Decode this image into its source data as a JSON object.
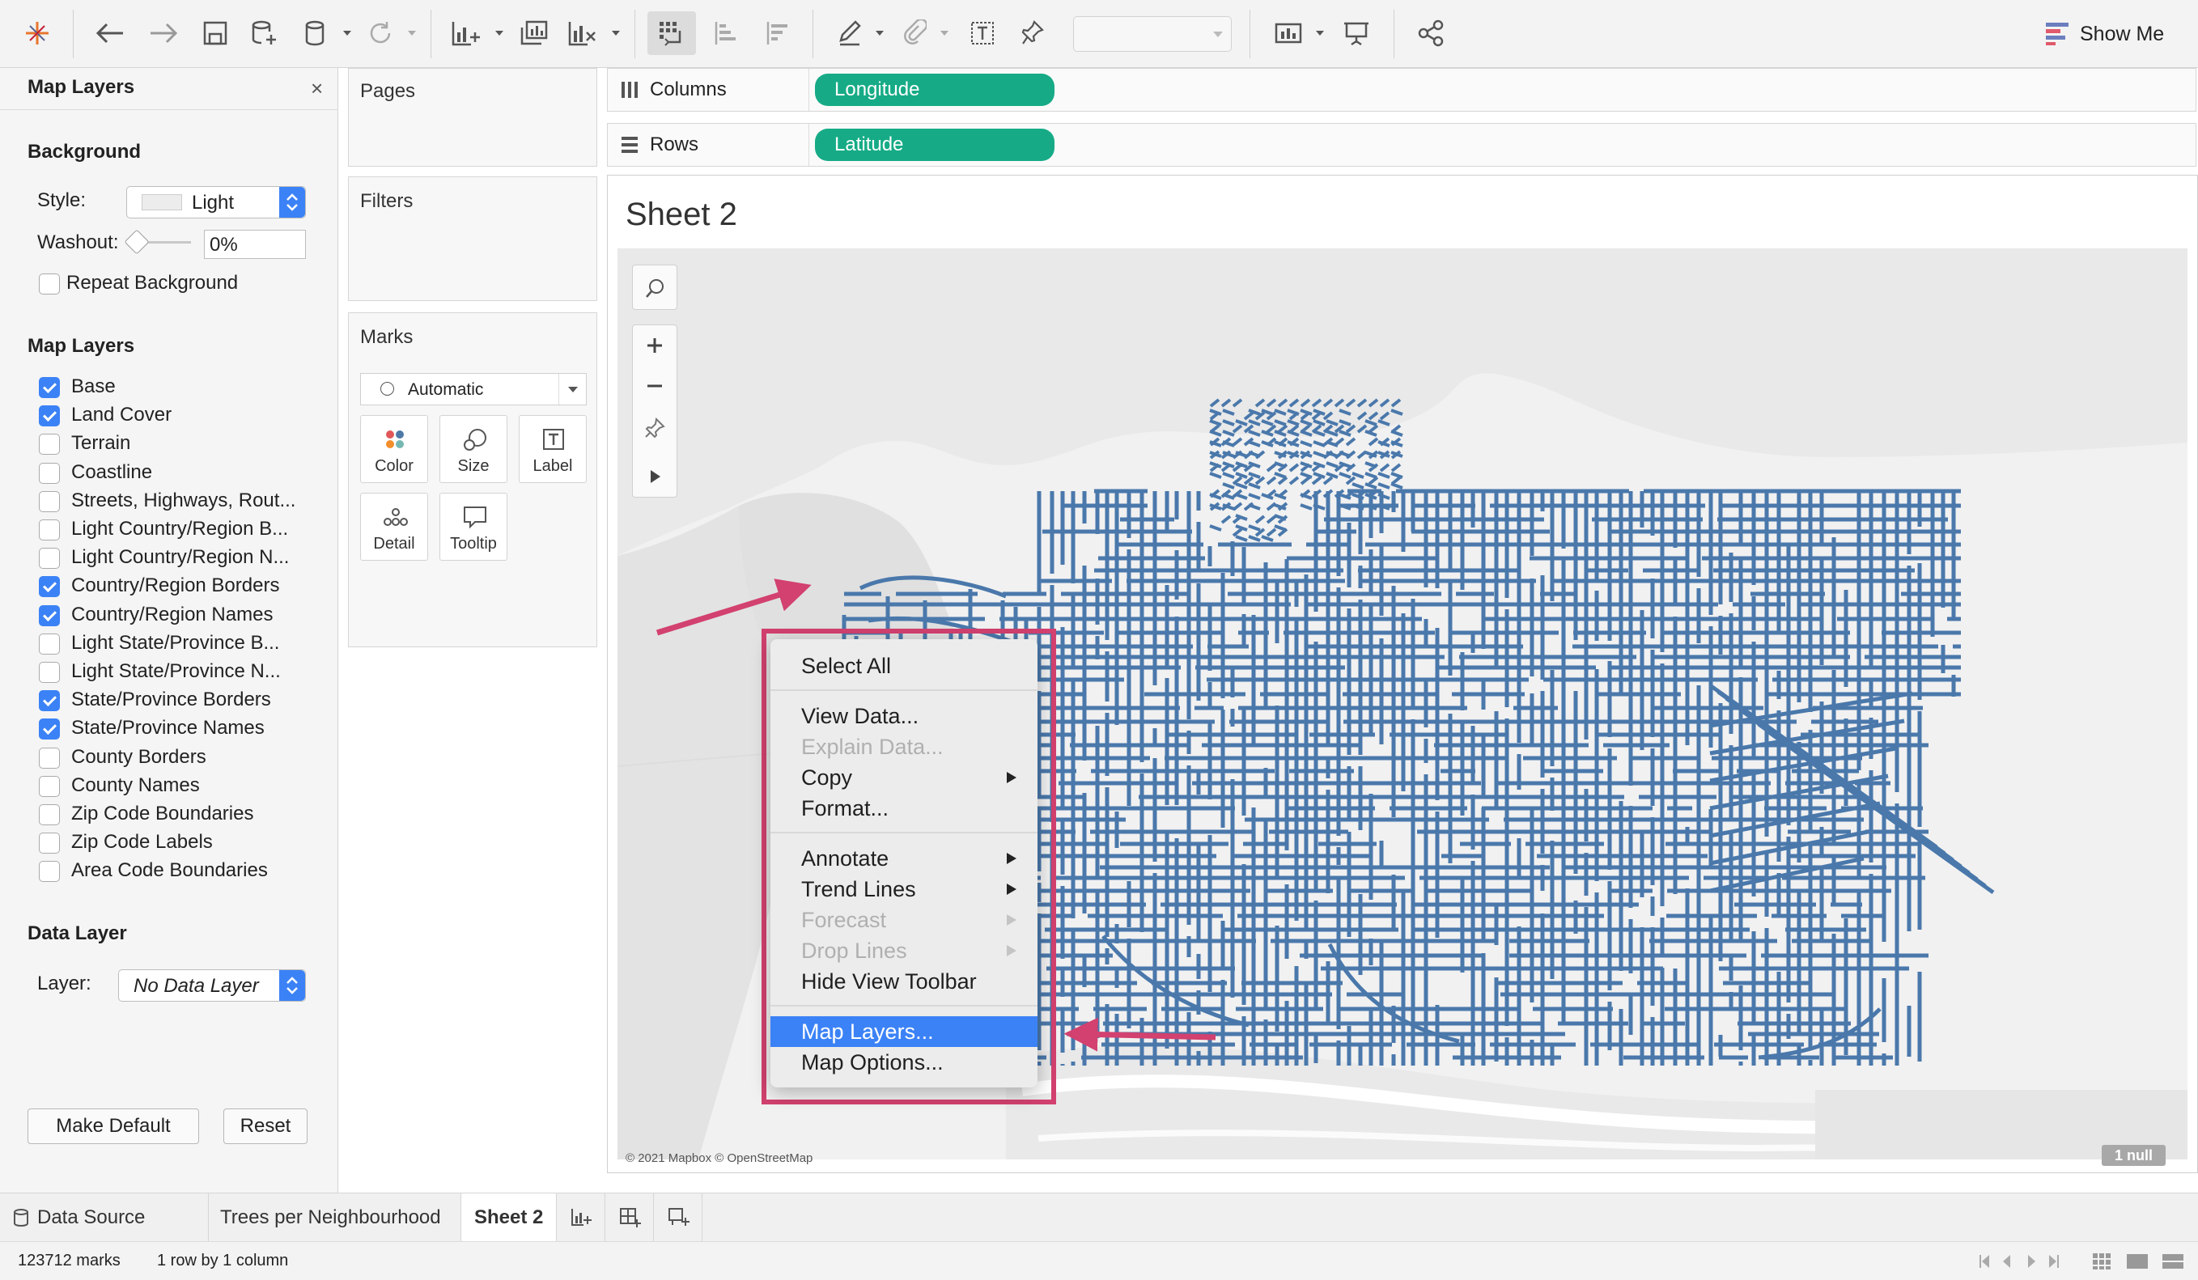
{
  "toolbar": {
    "show_me_label": "Show Me"
  },
  "map_layers_panel": {
    "title": "Map Layers",
    "background_heading": "Background",
    "style_label": "Style:",
    "style_value": "Light",
    "washout_label": "Washout:",
    "washout_value": "0%",
    "repeat_background_label": "Repeat Background",
    "repeat_background_checked": false,
    "layers_heading": "Map Layers",
    "layers": [
      {
        "label": "Base",
        "checked": true
      },
      {
        "label": "Land Cover",
        "checked": true
      },
      {
        "label": "Terrain",
        "checked": false
      },
      {
        "label": "Coastline",
        "checked": false
      },
      {
        "label": "Streets, Highways, Rout...",
        "checked": false
      },
      {
        "label": "Light Country/Region B...",
        "checked": false
      },
      {
        "label": "Light Country/Region N...",
        "checked": false
      },
      {
        "label": "Country/Region Borders",
        "checked": true
      },
      {
        "label": "Country/Region Names",
        "checked": true
      },
      {
        "label": "Light State/Province B...",
        "checked": false
      },
      {
        "label": "Light State/Province N...",
        "checked": false
      },
      {
        "label": "State/Province Borders",
        "checked": true
      },
      {
        "label": "State/Province Names",
        "checked": true
      },
      {
        "label": "County Borders",
        "checked": false
      },
      {
        "label": "County Names",
        "checked": false
      },
      {
        "label": "Zip Code Boundaries",
        "checked": false
      },
      {
        "label": "Zip Code Labels",
        "checked": false
      },
      {
        "label": "Area Code Boundaries",
        "checked": false
      }
    ],
    "data_layer_heading": "Data Layer",
    "layer_label": "Layer:",
    "layer_value": "No Data Layer",
    "make_default_label": "Make Default",
    "reset_label": "Reset"
  },
  "cards": {
    "pages_title": "Pages",
    "filters_title": "Filters",
    "marks_title": "Marks",
    "mark_type": "Automatic",
    "mark_buttons": [
      {
        "label": "Color"
      },
      {
        "label": "Size"
      },
      {
        "label": "Label"
      },
      {
        "label": "Detail"
      },
      {
        "label": "Tooltip"
      }
    ]
  },
  "shelves": {
    "columns_label": "Columns",
    "columns_pill": "Longitude",
    "rows_label": "Rows",
    "rows_pill": "Latitude"
  },
  "view": {
    "sheet_title": "Sheet 2",
    "attribution": "© 2021 Mapbox © OpenStreetMap",
    "null_badge": "1 null",
    "mark_color": "#4a78ab"
  },
  "context_menu": {
    "items": [
      {
        "label": "Select All",
        "enabled": true,
        "submenu": false
      },
      {
        "label": "View Data...",
        "enabled": true,
        "submenu": false
      },
      {
        "label": "Explain Data...",
        "enabled": false,
        "submenu": false
      },
      {
        "label": "Copy",
        "enabled": true,
        "submenu": true
      },
      {
        "label": "Format...",
        "enabled": true,
        "submenu": false
      },
      {
        "label": "Annotate",
        "enabled": true,
        "submenu": true
      },
      {
        "label": "Trend Lines",
        "enabled": true,
        "submenu": true
      },
      {
        "label": "Forecast",
        "enabled": false,
        "submenu": true
      },
      {
        "label": "Drop Lines",
        "enabled": false,
        "submenu": true
      },
      {
        "label": "Hide View Toolbar",
        "enabled": true,
        "submenu": false
      },
      {
        "label": "Map Layers...",
        "enabled": true,
        "submenu": false,
        "highlighted": true
      },
      {
        "label": "Map Options...",
        "enabled": true,
        "submenu": false
      }
    ]
  },
  "annotation_color": "#d2416f",
  "tabs": {
    "data_source": "Data Source",
    "sheet1": "Trees per Neighbourhood",
    "sheet2": "Sheet 2"
  },
  "status": {
    "marks": "123712 marks",
    "dims": "1 row by 1 column"
  }
}
